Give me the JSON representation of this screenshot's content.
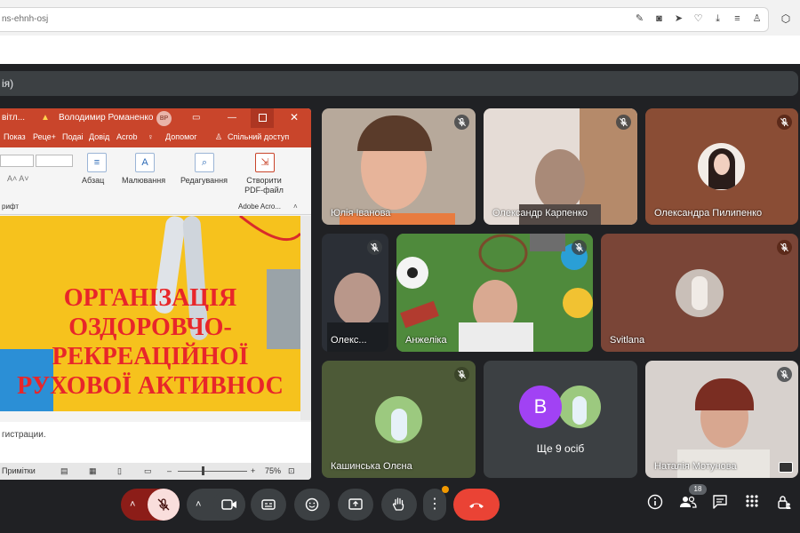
{
  "browser": {
    "url": "ns-ehnh-osj",
    "icons": [
      "edit-icon",
      "camera-icon",
      "send-icon",
      "heart-icon",
      "download-icon",
      "menu-lines-icon",
      "profile-icon",
      "extension-icon"
    ]
  },
  "banner": {
    "text": "ія)"
  },
  "ppt": {
    "title_fragment": "вітл...",
    "user_name": "Володимир Романенко",
    "user_initials": "ВР",
    "tabs": [
      "Показ",
      "Реце+",
      "Подаі",
      "Довід",
      "Acrob"
    ],
    "help_tab": "Допомог",
    "share_tab": "Спільний доступ",
    "ribbon": {
      "paragraph": "Абзац",
      "drawing": "Малювання",
      "editing": "Редагування",
      "create_pdf": "Створити PDF-файл",
      "adobe_group": "Adobe Acro...",
      "font_group": "рифт"
    },
    "slide_lines": [
      "ОРГАНІЗАЦІЯ",
      "ОЗДОРОВЧО-",
      "РЕКРЕАЦІЙНОЇ",
      "РУХОВОЇ АКТИВНОС"
    ],
    "notes_text": "гистрации.",
    "status": {
      "notes_label": "Примітки",
      "zoom": "75%"
    }
  },
  "participants": [
    {
      "name": "Юлія Іванова",
      "muted": true
    },
    {
      "name": "Олександр Карпенко",
      "muted": true
    },
    {
      "name": "Олександра Пилипенко",
      "muted": true
    },
    {
      "name": "Олекс...",
      "muted": true
    },
    {
      "name": "Анжеліка",
      "muted": true
    },
    {
      "name": "Svitlana",
      "muted": true
    },
    {
      "name": "Кашинська Олєна",
      "muted": true
    },
    {
      "others_label": "Ще 9 осіб",
      "initial": "В"
    },
    {
      "name": "Наталія Мотунова",
      "muted": true
    }
  ],
  "controls": {
    "participant_count": "18"
  },
  "colors": {
    "end_call": "#ea4335",
    "mic_off_bg": "#f9dedc",
    "ppt_red": "#c9452b",
    "avatar_purple": "#a142f4"
  }
}
